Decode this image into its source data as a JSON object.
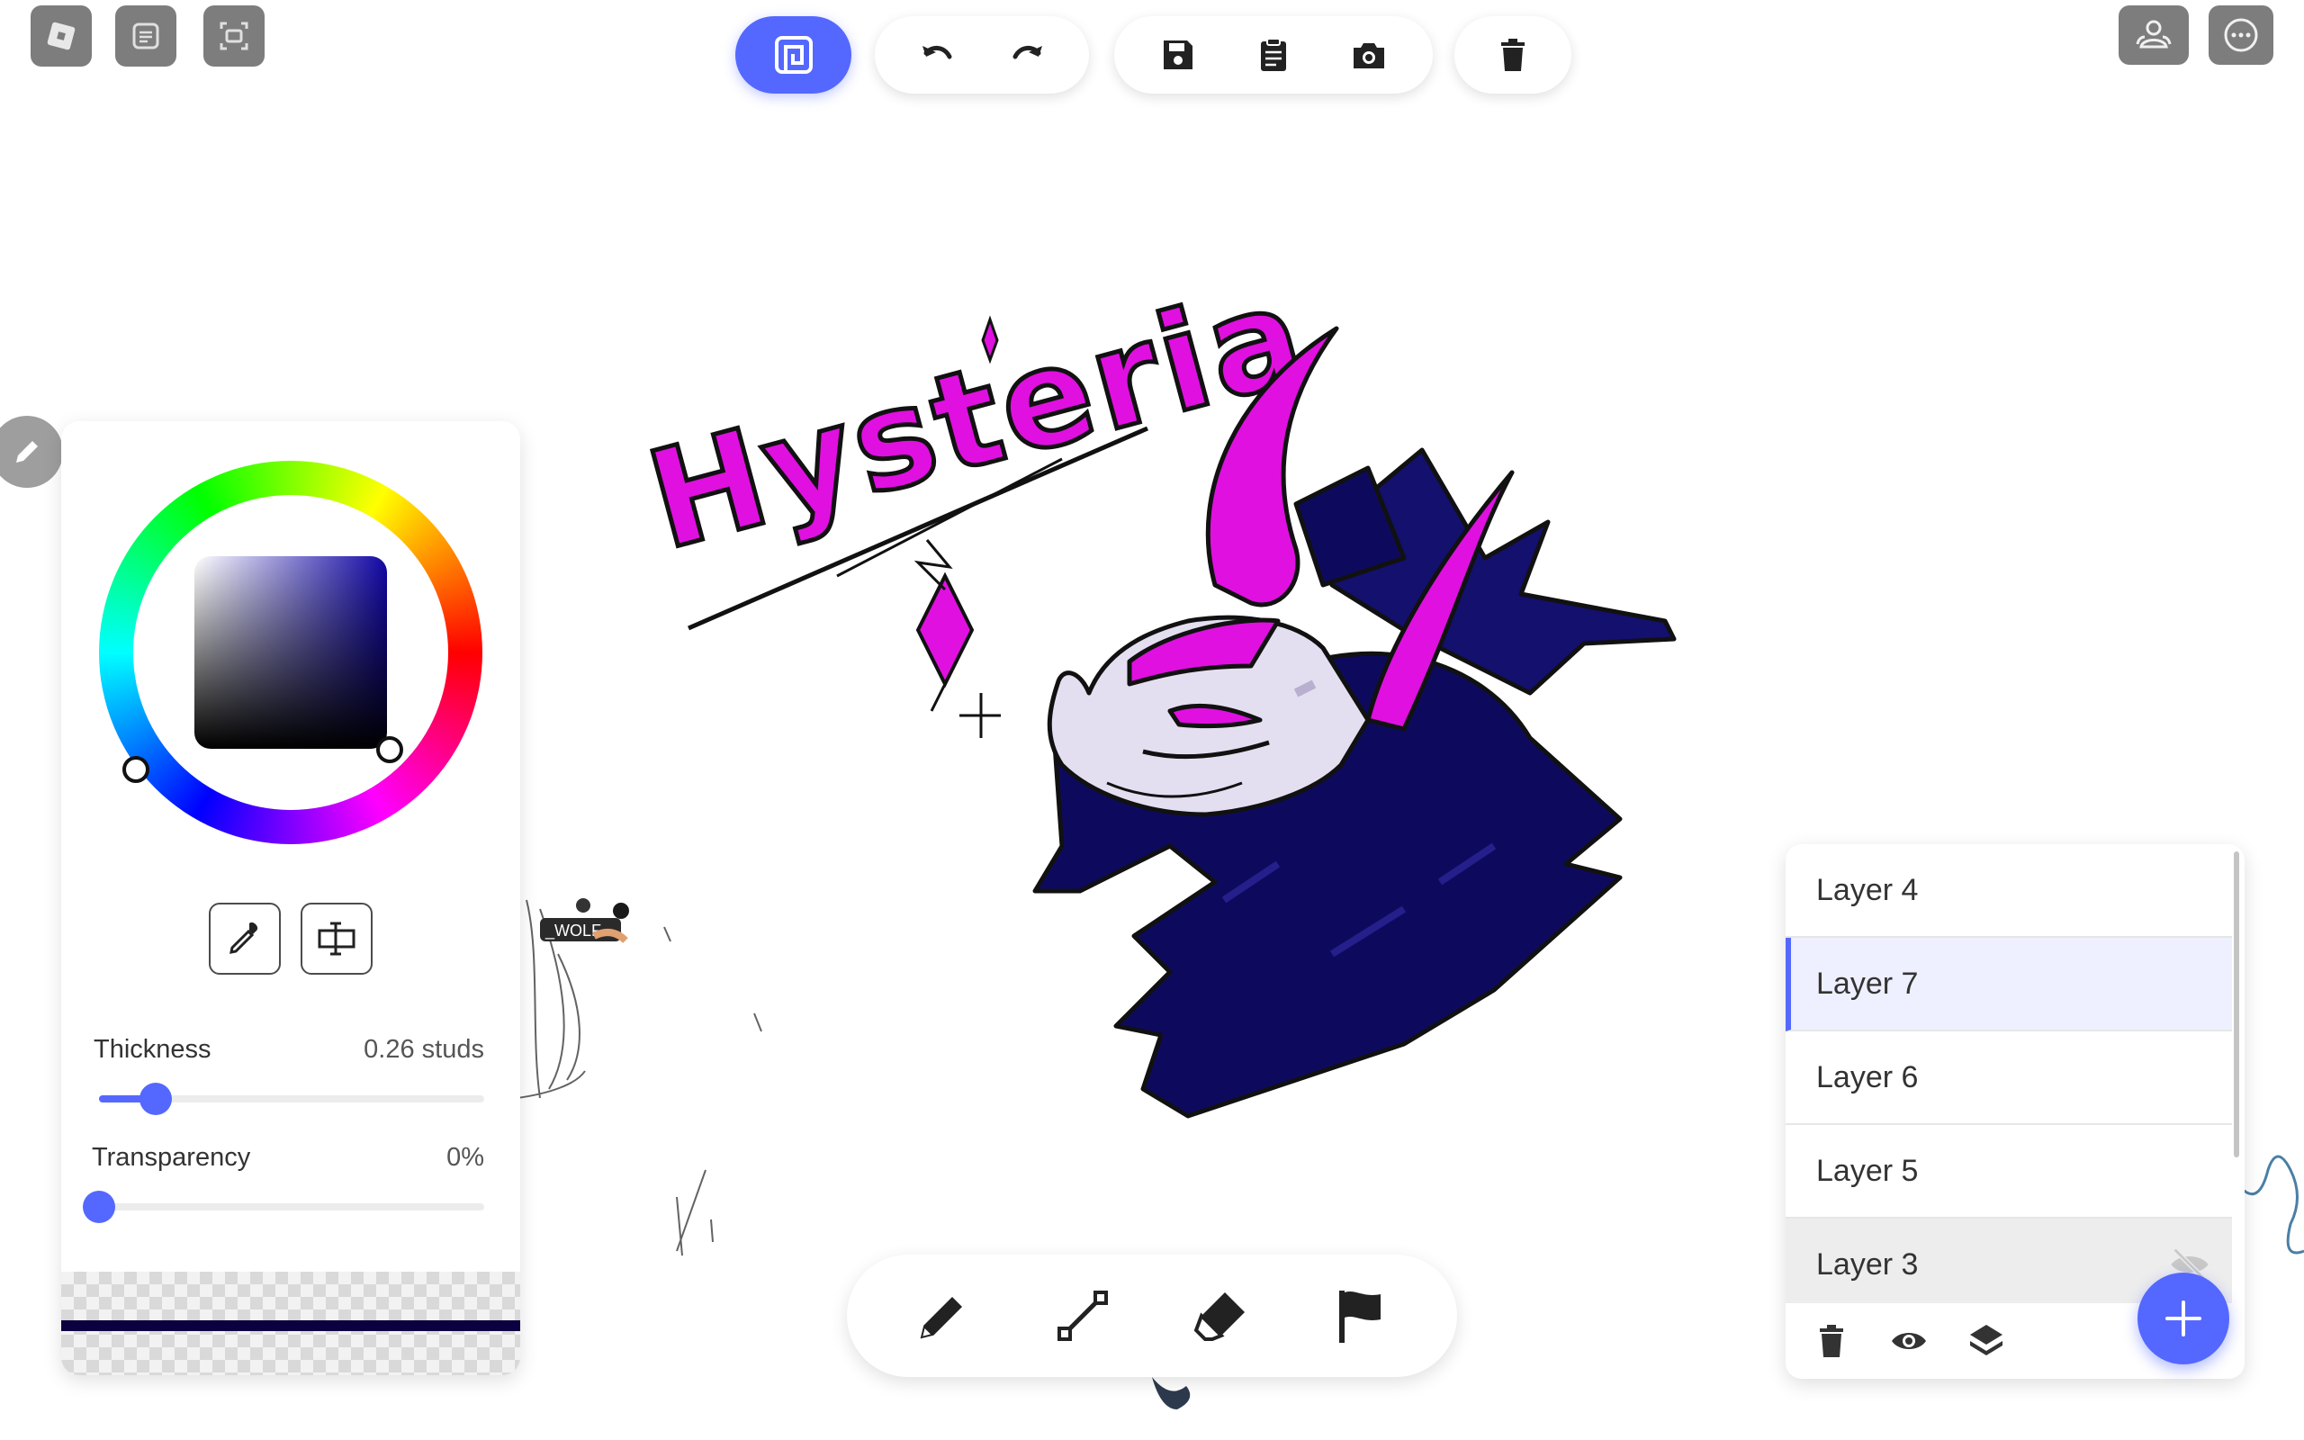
{
  "canvas": {
    "drawing_title": "Hysteria",
    "player_tag": "_WOLF"
  },
  "top_left": {
    "icons": [
      "roblox-logo-icon",
      "chat-icon",
      "screen-capture-icon"
    ]
  },
  "toolbar": {
    "icons": [
      "drawing-app-icon",
      "undo-icon",
      "redo-icon",
      "save-icon",
      "clipboard-icon",
      "camera-icon",
      "trash-icon"
    ]
  },
  "top_right": {
    "icons": [
      "friends-icon",
      "more-options-icon"
    ]
  },
  "color_panel": {
    "selected_color": "#1208a6",
    "hue_ring": "full-spectrum",
    "thickness_label": "Thickness",
    "thickness_value": "0.26 studs",
    "thickness_level": 0.1,
    "transparency_label": "Transparency",
    "transparency_value": "0%",
    "transparency_level": 0.0,
    "preview_stroke_color": "#0b0040"
  },
  "bottom_tools": {
    "icons": [
      "pencil-icon",
      "line-icon",
      "eraser-icon",
      "flag-icon"
    ]
  },
  "layers": {
    "items": [
      {
        "label": "Layer 4",
        "state": "normal"
      },
      {
        "label": "Layer 7",
        "state": "active"
      },
      {
        "label": "Layer 6",
        "state": "normal"
      },
      {
        "label": "Layer 5",
        "state": "normal"
      },
      {
        "label": "Layer 3",
        "state": "hidden"
      }
    ],
    "footer_icons": [
      "delete-layer-icon",
      "visibility-icon",
      "layers-icon"
    ],
    "add_icon": "plus-icon"
  },
  "colors": {
    "accent": "#5468ff",
    "magenta": "#e010e0",
    "navy": "#0d0a5e",
    "bone": "#e4dff0"
  }
}
